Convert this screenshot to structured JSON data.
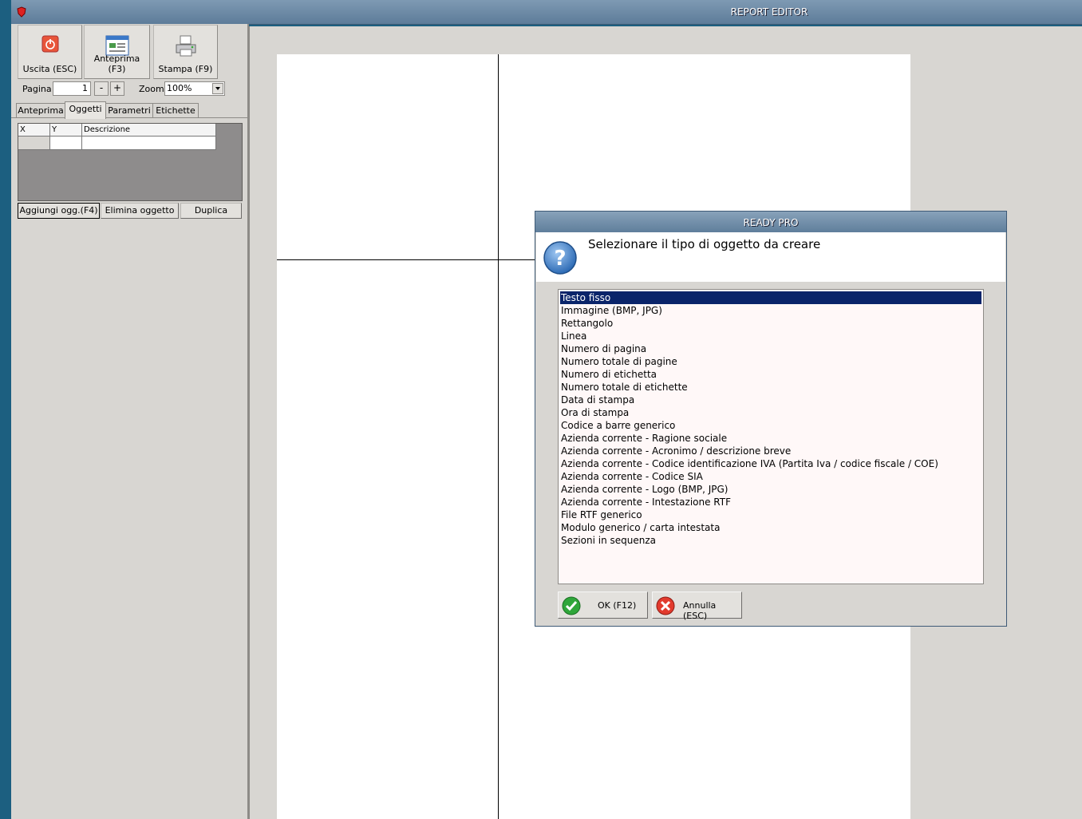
{
  "window": {
    "title": "REPORT EDITOR"
  },
  "toolbar": {
    "exit_label": "Uscita (ESC)",
    "preview_label": "Anteprima (F3)",
    "print_label": "Stampa (F9)"
  },
  "pager": {
    "page_label": "Pagina",
    "page_value": "1",
    "minus": "-",
    "plus": "+",
    "zoom_label": "Zoom",
    "zoom_value": "100%"
  },
  "tabs": [
    {
      "label": "Anteprima"
    },
    {
      "label": "Oggetti"
    },
    {
      "label": "Parametri"
    },
    {
      "label": "Etichette"
    }
  ],
  "objects_table": {
    "columns": [
      "X",
      "Y",
      "Descrizione"
    ]
  },
  "object_buttons": {
    "add": "Aggiungi ogg.(F4)",
    "delete": "Elimina oggetto",
    "duplicate": "Duplica"
  },
  "dialog": {
    "title": "READY PRO",
    "message": "Selezionare il tipo di oggetto da creare",
    "items": [
      "Testo fisso",
      "Immagine (BMP, JPG)",
      "Rettangolo",
      "Linea",
      "Numero di pagina",
      "Numero totale di pagine",
      "Numero di etichetta",
      "Numero totale di etichette",
      "Data di stampa",
      "Ora di stampa",
      "Codice a barre generico",
      "Azienda corrente - Ragione sociale",
      "Azienda corrente - Acronimo / descrizione breve",
      "Azienda corrente - Codice identificazione IVA (Partita Iva / codice fiscale / COE)",
      "Azienda corrente - Codice SIA",
      "Azienda corrente - Logo (BMP, JPG)",
      "Azienda corrente - Intestazione RTF",
      "File RTF generico",
      "Modulo generico / carta intestata",
      "Sezioni in sequenza"
    ],
    "selected_index": 0,
    "ok_label": "OK (F12)",
    "cancel_label": "Annulla (ESC)"
  },
  "colors": {
    "titlebar": "#5d7c99",
    "selection": "#0a246a",
    "panel": "#d8d6d2"
  }
}
